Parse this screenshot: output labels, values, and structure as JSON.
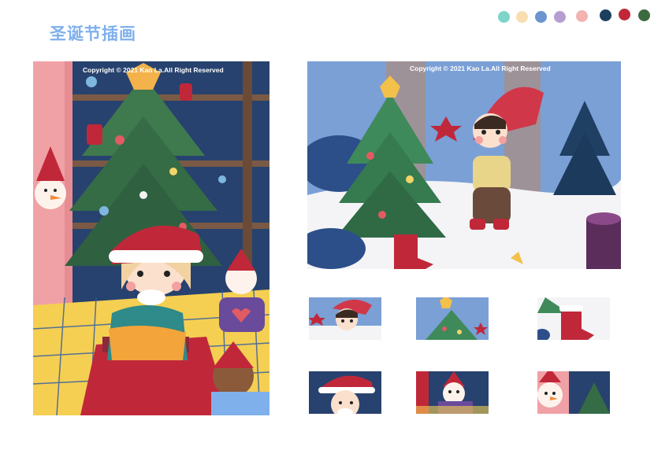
{
  "page": {
    "title": "圣诞节插画"
  },
  "palette": [
    {
      "name": "mint",
      "color": "#7fd4c9"
    },
    {
      "name": "cream",
      "color": "#f7ddb0"
    },
    {
      "name": "blue",
      "color": "#6a95cf"
    },
    {
      "name": "lavender",
      "color": "#b79ed2"
    },
    {
      "name": "pink",
      "color": "#f2b3b3"
    },
    {
      "name": "navy",
      "color": "#1c3f5e"
    },
    {
      "name": "red",
      "color": "#c0283a"
    },
    {
      "name": "green",
      "color": "#3d6a3f"
    }
  ],
  "left_illustration": {
    "copyright": "Copyright © 2021 Kao La.All Right Reserved",
    "scene": "girl-with-santa-hat-under-christmas-tree"
  },
  "right_illustration": {
    "copyright": "Copyright © 2021 Kao La.All Right Reserved",
    "scene": "boy-elf-decorating-tree-in-snow"
  },
  "detail_crops": [
    {
      "name": "boy-elf-detail"
    },
    {
      "name": "tree-star-detail"
    },
    {
      "name": "stocking-detail"
    },
    {
      "name": "girl-face-detail"
    },
    {
      "name": "snowman-detail"
    },
    {
      "name": "ornament-face-detail"
    }
  ]
}
